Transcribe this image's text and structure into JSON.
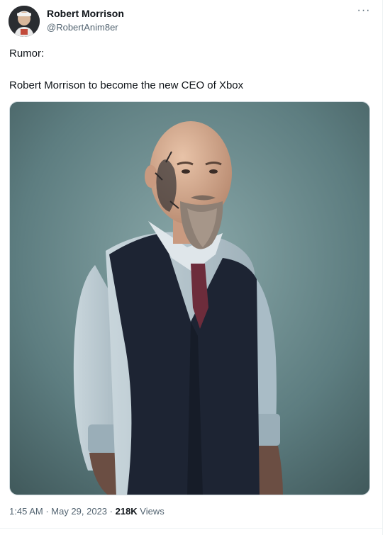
{
  "author": {
    "name": "Robert Morrison",
    "handle": "@RobertAnim8er"
  },
  "menu": {
    "more_icon": "more-horizontal-icon",
    "label": "···"
  },
  "tweet": {
    "line1": "Rumor:",
    "line2": "Robert Morrison to become the new CEO of Xbox"
  },
  "meta": {
    "time": "1:45 AM",
    "sep1": " · ",
    "date": "May 29, 2023",
    "sep2": " · ",
    "views_count": "218K",
    "views_label": " Views"
  },
  "colors": {
    "text_primary": "#0f1419",
    "text_secondary": "#536471",
    "border": "#cfd9de",
    "photo_background": "#5a7a7c"
  }
}
